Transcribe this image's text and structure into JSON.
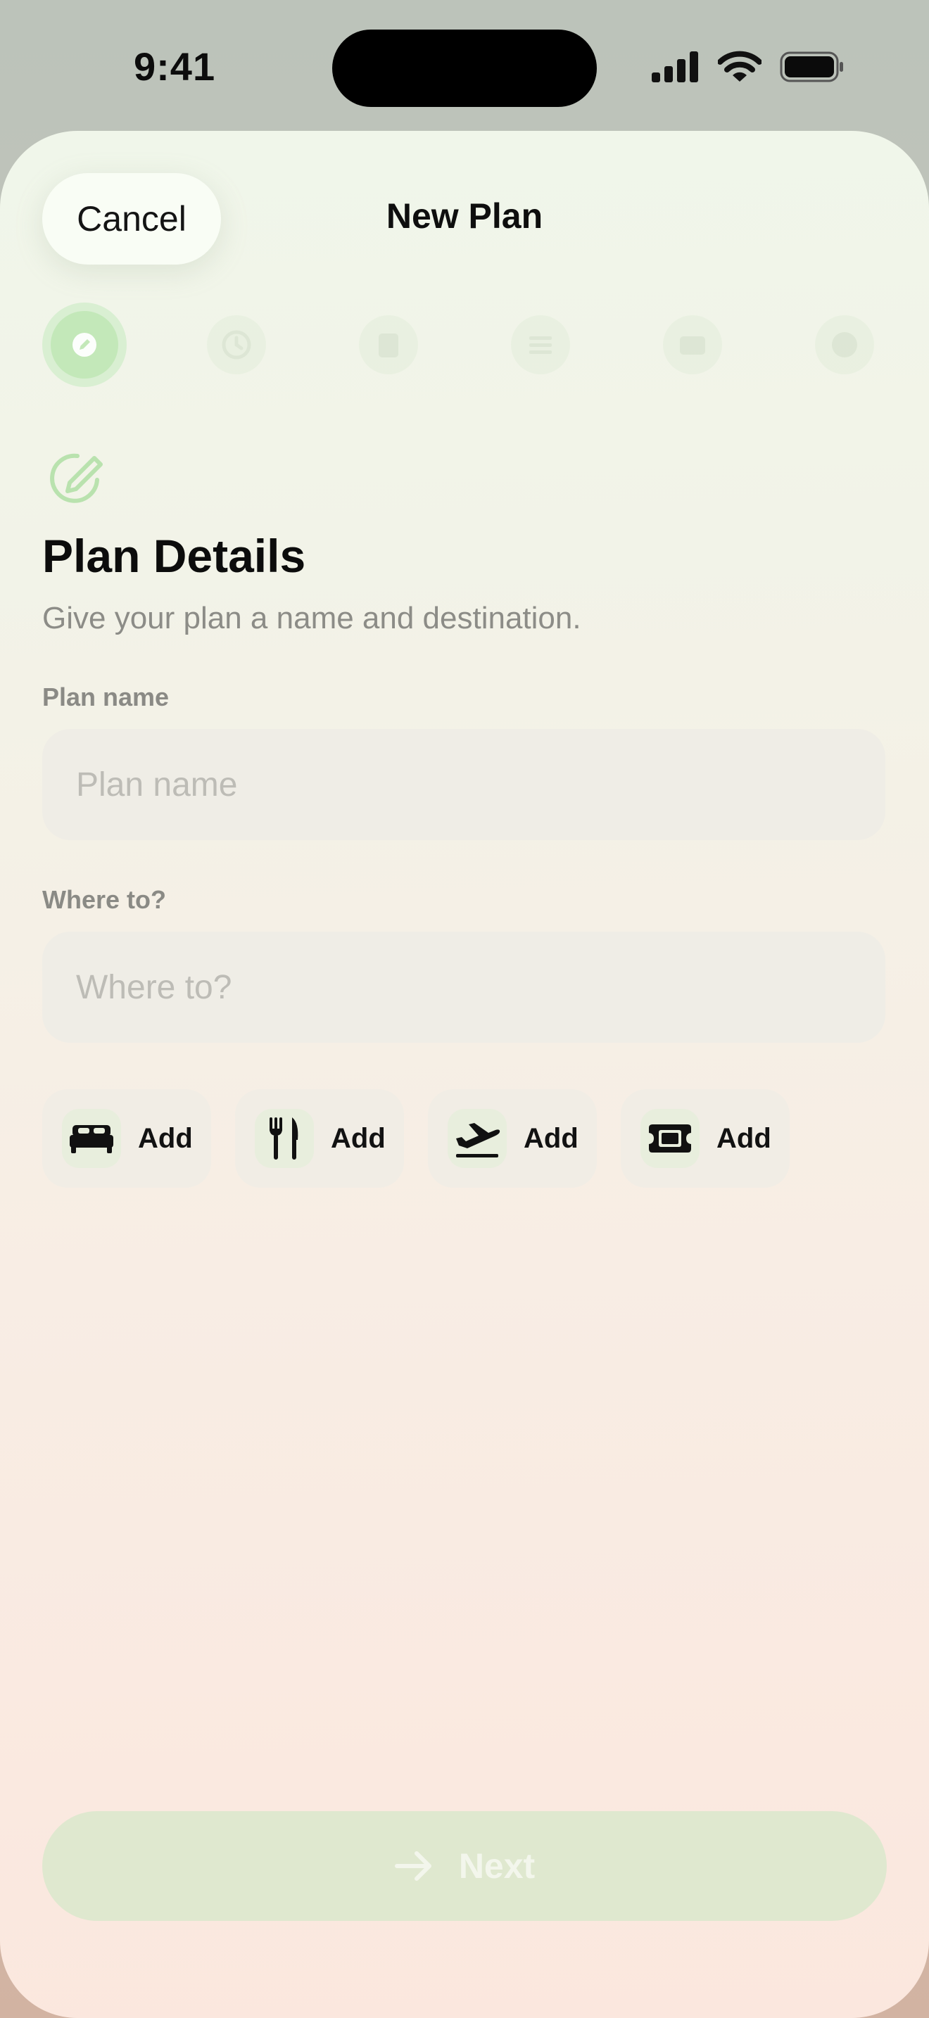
{
  "status_bar": {
    "time": "9:41",
    "icons": [
      "cellular-signal-icon",
      "wifi-icon",
      "battery-icon"
    ]
  },
  "sheet": {
    "cancel_label": "Cancel",
    "title": "New Plan"
  },
  "steps": {
    "items": [
      "pencil-icon",
      "clock-icon",
      "clipboard-icon",
      "checklist-icon",
      "card-icon",
      "checkmark-icon"
    ],
    "active_index": 0
  },
  "section": {
    "icon": "pencil-circle-icon",
    "title": "Plan Details",
    "subtitle": "Give your plan a name and destination."
  },
  "form": {
    "plan_name_label": "Plan name",
    "plan_name_placeholder": "Plan name",
    "plan_name_value": "",
    "destination_label": "Where to?",
    "destination_placeholder": "Where to?",
    "destination_value": ""
  },
  "chips": [
    {
      "icon": "bed-icon",
      "label": "Add"
    },
    {
      "icon": "fork-knife-icon",
      "label": "Add"
    },
    {
      "icon": "airplane-departure-icon",
      "label": "Add"
    },
    {
      "icon": "ticket-icon",
      "label": "Add"
    }
  ],
  "footer": {
    "next_label": "Next",
    "next_icon": "arrow-right-icon"
  },
  "colors": {
    "accent_green": "#c3e8b9",
    "next_button_disabled": "#dfe8cf",
    "field_background": "#efede6"
  }
}
